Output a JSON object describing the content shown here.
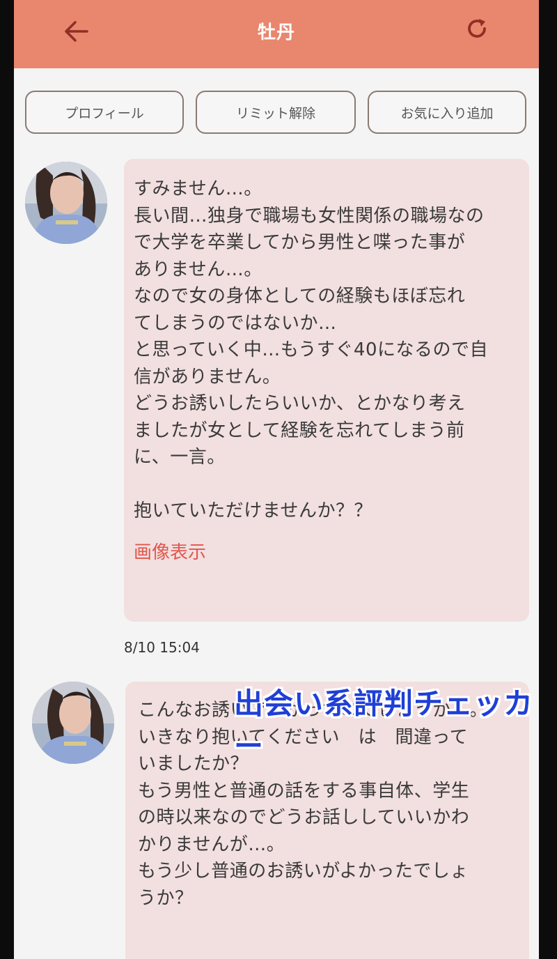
{
  "appbar": {
    "title": "牡丹",
    "back_icon": "arrow-left-icon",
    "reload_icon": "refresh-icon",
    "color": "#e9866e"
  },
  "actions": {
    "profile_label": "プロフィール",
    "limit_release_label": "リミット解除",
    "add_favorite_label": "お気に入り追加"
  },
  "messages": [
    {
      "text": "すみません…。\n長い間…独身で職場も女性関係の職場なの\nで大学を卒業してから男性と喋った事が\nありません…。\nなので女の身体としての経験もほぼ忘れ\nてしまうのではないか…\nと思っていく中…もうすぐ40になるので自\n信がありません。\nどうお誘いしたらいいか、とかなり考え\nましたが女として経験を忘れてしまう前\nに、一言。",
      "question": "抱いていただけませんか？？",
      "image_link": "画像表示",
      "time": "8/10 15:04"
    },
    {
      "text": "こんなお誘いでよかったのでしょうか…。\nいきなり抱いてください　は　間違って\nいましたか？\nもう男性と普通の話をする事自体、学生\nの時以来なのでどうお話ししていいかわ\nかりませんが…。\nもう少し普通のお誘いがよかったでしょ\nうか？"
    }
  ],
  "watermark": "出会い系評判チェッカー",
  "colors": {
    "bubble": "#f2dfe0",
    "link": "#e0574c",
    "watermark": "#1f3fd6"
  }
}
